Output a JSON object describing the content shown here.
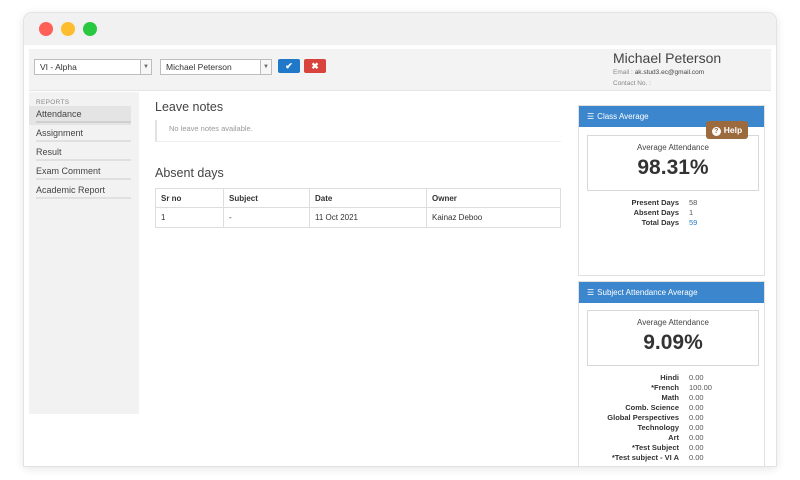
{
  "topbar": {
    "class_select": "VI - Alpha",
    "student_select": "Michael Peterson",
    "confirm_icon": "check-icon",
    "cancel_icon": "close-icon"
  },
  "user": {
    "name": "Michael Peterson",
    "email_label": "Email :",
    "email": "ak.stud3.ec@gmail.com",
    "contact_label": "Contact No. :"
  },
  "sidebar": {
    "heading": "REPORTS",
    "items": [
      {
        "label": "Attendance"
      },
      {
        "label": "Assignment"
      },
      {
        "label": "Result"
      },
      {
        "label": "Exam Comment"
      },
      {
        "label": "Academic Report"
      }
    ]
  },
  "leave_notes": {
    "title": "Leave notes",
    "empty_text": "No leave notes available."
  },
  "absent_days": {
    "title": "Absent days",
    "columns": [
      "Sr no",
      "Subject",
      "Date",
      "Owner"
    ],
    "rows": [
      [
        "1",
        "-",
        "11 Oct 2021",
        "Kainaz Deboo"
      ]
    ]
  },
  "class_average": {
    "title": "Class Average",
    "avg_label": "Average Attendance",
    "avg_value": "98.31%",
    "stats": [
      {
        "label": "Present Days",
        "value": "58"
      },
      {
        "label": "Absent Days",
        "value": "1"
      },
      {
        "label": "Total Days",
        "value": "59"
      }
    ]
  },
  "subject_average": {
    "title": "Subject Attendance Average",
    "avg_label": "Average Attendance",
    "avg_value": "9.09%",
    "subjects": [
      {
        "label": "Hindi",
        "value": "0.00"
      },
      {
        "label": "*French",
        "value": "100.00"
      },
      {
        "label": "Math",
        "value": "0.00"
      },
      {
        "label": "Comb. Science",
        "value": "0.00"
      },
      {
        "label": "Global Perspectives",
        "value": "0.00"
      },
      {
        "label": "Technology",
        "value": "0.00"
      },
      {
        "label": "Art",
        "value": "0.00"
      },
      {
        "label": "*Test Subject",
        "value": "0.00"
      },
      {
        "label": "*Test subject - VI A",
        "value": "0.00"
      }
    ]
  },
  "help_button": "Help",
  "colors": {
    "panel_header": "#3b86cc",
    "confirm": "#1f78c8",
    "cancel": "#d9433d",
    "help": "#9b6a3d"
  }
}
